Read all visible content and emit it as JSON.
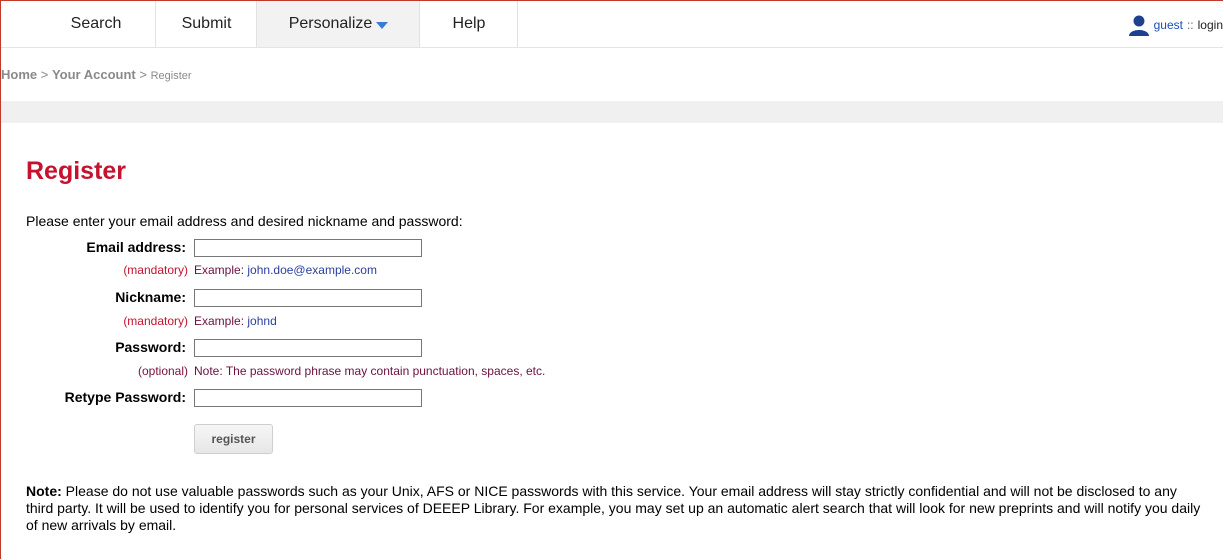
{
  "nav": {
    "tabs": [
      {
        "label": "Search"
      },
      {
        "label": "Submit"
      },
      {
        "label": "Personalize"
      },
      {
        "label": "Help"
      }
    ],
    "user": {
      "name": "guest",
      "separator": "::",
      "login": "login"
    }
  },
  "breadcrumb": {
    "home": "Home",
    "sep1": ">",
    "account": "Your Account",
    "sep2": ">",
    "current": "Register"
  },
  "page": {
    "title": "Register",
    "intro": "Please enter your email address and desired nickname and password:"
  },
  "form": {
    "email": {
      "label": "Email address:",
      "status": "(mandatory)",
      "example_label": "Example:",
      "example_value": "john.doe@example.com",
      "value": ""
    },
    "nickname": {
      "label": "Nickname:",
      "status": "(mandatory)",
      "example_label": "Example:",
      "example_value": "johnd",
      "value": ""
    },
    "password": {
      "label": "Password:",
      "status": "(optional)",
      "note_label": "Note:",
      "note_value": "The password phrase may contain punctuation, spaces, etc.",
      "value": ""
    },
    "retype": {
      "label": "Retype Password:",
      "value": ""
    },
    "submit_label": "register"
  },
  "note": {
    "label": "Note:",
    "text": "Please do not use valuable passwords such as your Unix, AFS or NICE passwords with this service. Your email address will stay strictly confidential and will not be disclosed to any third party. It will be used to identify you for personal services of DEEEP Library. For example, you may set up an automatic alert search that will look for new preprints and will notify you daily of new arrivals by email."
  },
  "colors": {
    "title": "#c4122f",
    "mandatory": "#c4122f",
    "link": "#2a3fa0"
  }
}
